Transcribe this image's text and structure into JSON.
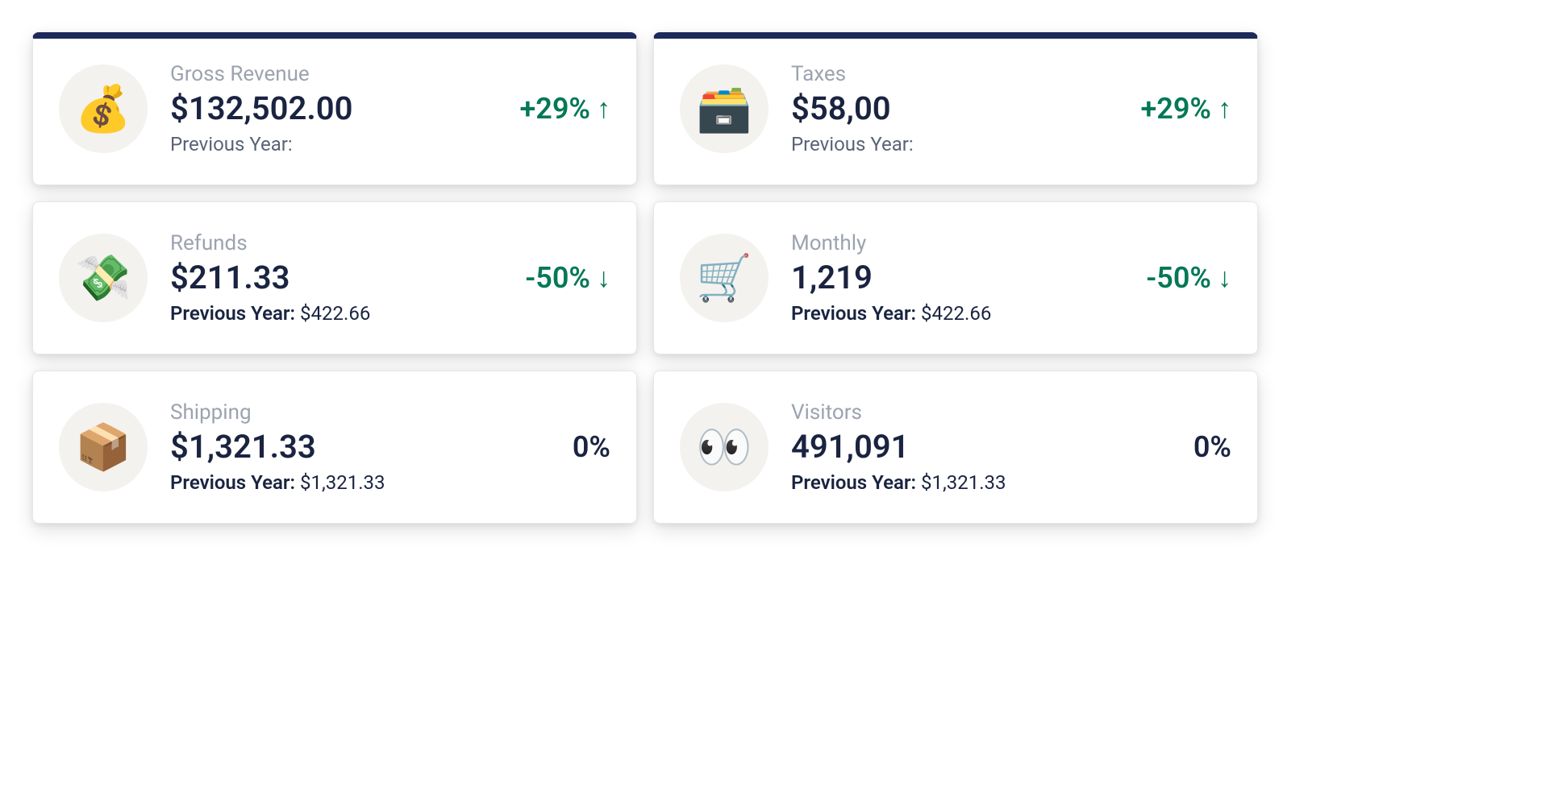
{
  "cards": [
    {
      "id": "gross-revenue",
      "topBar": true,
      "icon": "💰",
      "iconName": "money-bag-icon",
      "title": "Gross Revenue",
      "value": "$132,502.00",
      "prevLabel": "Previous Year:",
      "prevValue": "",
      "prevLight": true,
      "delta": "+29%",
      "arrow": "↑",
      "deltaClass": "green"
    },
    {
      "id": "taxes",
      "topBar": true,
      "icon": "🗃️",
      "iconName": "file-box-icon",
      "title": "Taxes",
      "value": "$58,00",
      "prevLabel": "Previous Year:",
      "prevValue": "",
      "prevLight": true,
      "delta": "+29%",
      "arrow": "↑",
      "deltaClass": "green"
    },
    {
      "id": "refunds",
      "topBar": false,
      "icon": "💸",
      "iconName": "money-wings-icon",
      "title": "Refunds",
      "value": "$211.33",
      "prevLabel": "Previous Year:",
      "prevValue": "$422.66",
      "prevLight": false,
      "delta": "-50%",
      "arrow": "↓",
      "deltaClass": "green"
    },
    {
      "id": "monthly",
      "topBar": false,
      "icon": "🛒",
      "iconName": "shopping-cart-icon",
      "title": "Monthly",
      "value": "1,219",
      "prevLabel": "Previous Year:",
      "prevValue": "$422.66",
      "prevLight": false,
      "delta": "-50%",
      "arrow": "↓",
      "deltaClass": "green"
    },
    {
      "id": "shipping",
      "topBar": false,
      "icon": "📦",
      "iconName": "package-icon",
      "title": "Shipping",
      "value": "$1,321.33",
      "prevLabel": "Previous Year:",
      "prevValue": "$1,321.33",
      "prevLight": false,
      "delta": "0%",
      "arrow": "",
      "deltaClass": "neutral"
    },
    {
      "id": "visitors",
      "topBar": false,
      "icon": "👀",
      "iconName": "eyes-icon",
      "title": "Visitors",
      "value": "491,091",
      "prevLabel": "Previous Year:",
      "prevValue": "$1,321.33",
      "prevLight": false,
      "delta": "0%",
      "arrow": "",
      "deltaClass": "neutral"
    }
  ]
}
